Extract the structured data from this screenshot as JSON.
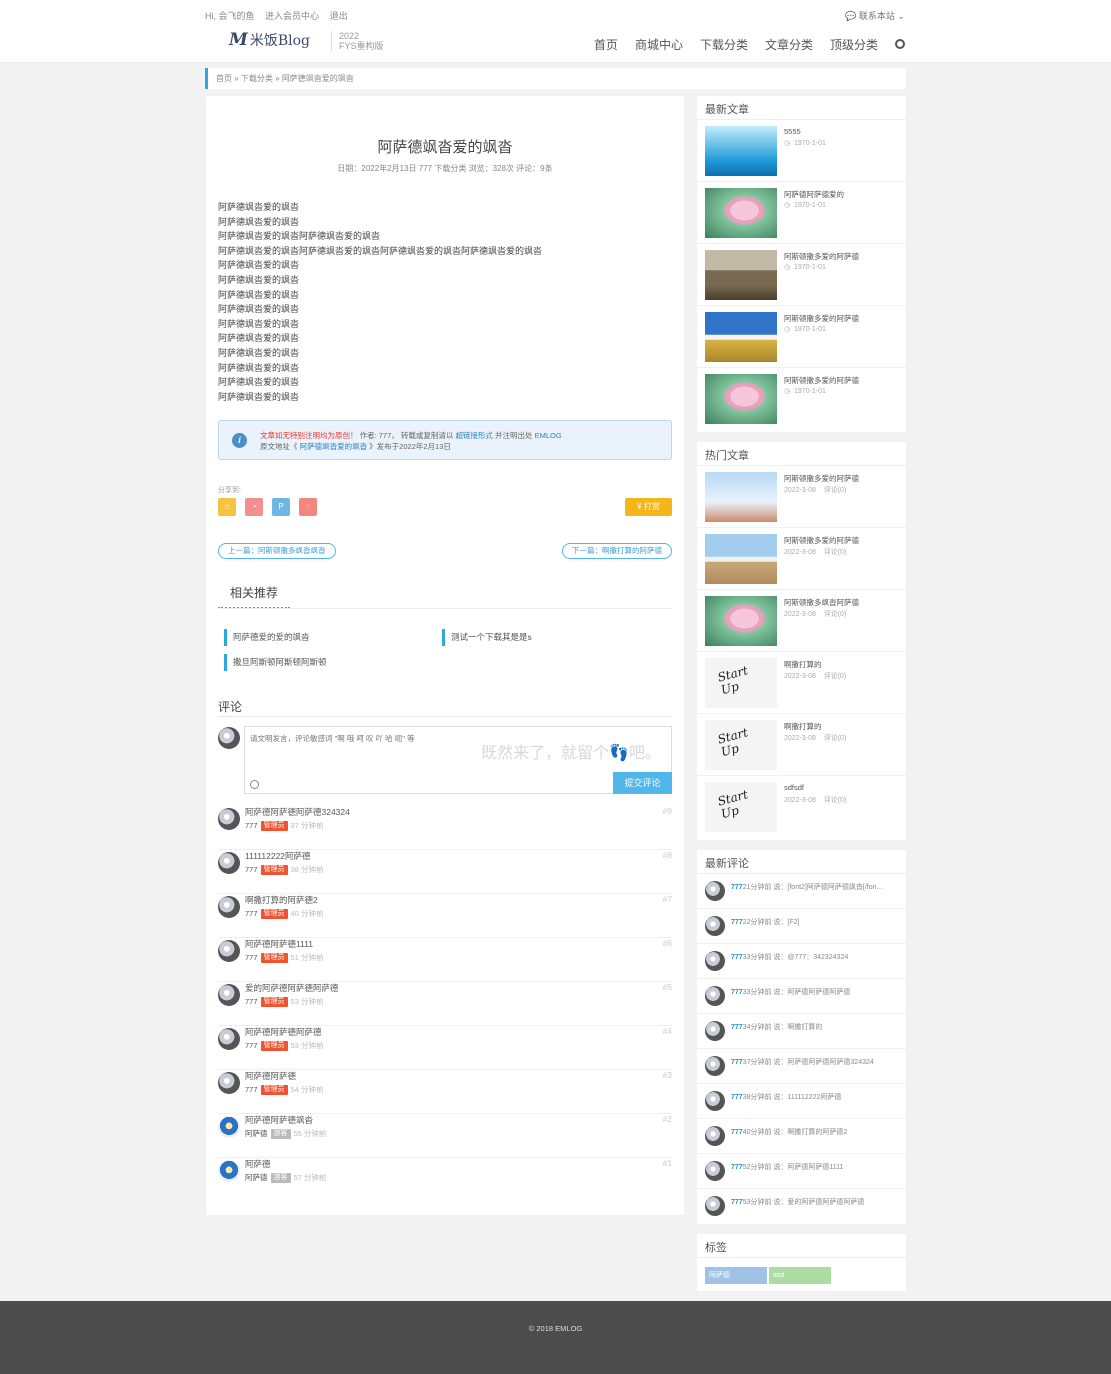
{
  "topbar": {
    "greeting": "Hi, 会飞的鱼",
    "member_center": "进入会员中心",
    "logout": "退出",
    "contact": "联系本站",
    "logo_mark": "M",
    "logo_text": "米饭Blog",
    "version_year": "2022",
    "version_name": "FYS重构版",
    "nav": [
      "首页",
      "商城中心",
      "下载分类",
      "文章分类",
      "顶级分类"
    ]
  },
  "breadcrumb": [
    "首页",
    "下载分类",
    "阿萨德飒沓爱的飒沓"
  ],
  "article": {
    "title": "阿萨德飒沓爱的飒沓",
    "meta": "日期：2022年2月13日  777  下载分类  浏览：328次  评论：9条",
    "lines": [
      "阿萨德飒沓爱的飒沓",
      "阿萨德飒沓爱的飒沓",
      "阿萨德飒沓爱的飒沓阿萨德飒沓爱的飒沓",
      "阿萨德飒沓爱的飒沓阿萨德飒沓爱的飒沓阿萨德飒沓爱的飒沓阿萨德飒沓爱的飒沓",
      "阿萨德飒沓爱的飒沓",
      "阿萨德飒沓爱的飒沓",
      "阿萨德飒沓爱的飒沓",
      "阿萨德飒沓爱的飒沓",
      "阿萨德飒沓爱的飒沓",
      "阿萨德飒沓爱的飒沓",
      "阿萨德飒沓爱的飒沓",
      "阿萨德飒沓爱的飒沓",
      "阿萨德飒沓爱的飒沓",
      "阿萨德飒沓爱的飒沓"
    ],
    "notice_red": "文章如无特别注明均为原创！",
    "notice_mid": " 作者: 777，  转载或复制请以 ",
    "notice_link": "超链接形式",
    "notice_end": " 并注明出处 ",
    "notice_site": "EMLOG",
    "notice2_pre": "原文地址《 ",
    "notice2_link": "阿萨德飒沓爱的飒沓",
    "notice2_post": " 》发布于2022年2月13日",
    "share_label": "分享到:",
    "reward": "¥ 打赏",
    "prev": "上一篇：阿斯顿撒多飒沓飒沓",
    "next": "下一篇：啊撒打算的阿萨德",
    "related_title": "相关推荐",
    "related": [
      "阿萨德爱的爱的飒沓",
      "测试一个下载其是是s",
      "撒旦阿斯顿阿斯顿阿斯顿"
    ]
  },
  "comment_form": {
    "title": "评论",
    "placeholder": "请文明发言，评论敏感词 \"啊 哦 呵 叹 吖 哈 呃\" 等",
    "slogan": "既然来了，就留个👣吧。",
    "submit": "提交评论"
  },
  "comments": [
    {
      "text": "阿萨德阿萨德阿萨德324324",
      "user": "777",
      "role": "管理员",
      "time": "37 分钟前",
      "num": "#9"
    },
    {
      "text": "111112222阿萨德",
      "user": "777",
      "role": "管理员",
      "time": "38 分钟前",
      "num": "#8"
    },
    {
      "text": "啊撒打算的阿萨德2",
      "user": "777",
      "role": "管理员",
      "time": "40 分钟前",
      "num": "#7"
    },
    {
      "text": "阿萨德阿萨德1111",
      "user": "777",
      "role": "管理员",
      "time": "51 分钟前",
      "num": "#6"
    },
    {
      "text": "爱的阿萨德阿萨德阿萨德",
      "user": "777",
      "role": "管理员",
      "time": "53 分钟前",
      "num": "#5"
    },
    {
      "text": "阿萨德阿萨德阿萨德",
      "user": "777",
      "role": "管理员",
      "time": "53 分钟前",
      "num": "#4"
    },
    {
      "text": "阿萨德阿萨德",
      "user": "777",
      "role": "管理员",
      "time": "54 分钟前",
      "num": "#3"
    },
    {
      "text": "阿萨德阿萨德飒沓",
      "user": "阿萨德",
      "role": "游客",
      "time": "55 分钟前",
      "num": "#2"
    },
    {
      "text": "阿萨德",
      "user": "阿萨德",
      "role": "游客",
      "time": "57 分钟前",
      "num": "#1"
    }
  ],
  "sidebar": {
    "latest_title": "最新文章",
    "latest": [
      {
        "title": "5555",
        "date": "1970-1-01"
      },
      {
        "title": "阿萨德阿萨德爱的",
        "date": "1970-1-01"
      },
      {
        "title": "阿斯顿撒多爱的阿萨德",
        "date": "1970-1-01"
      },
      {
        "title": "阿斯顿撒多爱的阿萨德",
        "date": "1970-1-01"
      },
      {
        "title": "阿斯顿撒多爱的阿萨德",
        "date": "1970-1-01"
      }
    ],
    "hot_title": "热门文章",
    "hot": [
      {
        "title": "阿斯顿撒多爱的阿萨德",
        "date": "2022-3-08",
        "comments": "评论(0)"
      },
      {
        "title": "阿斯顿撒多爱的阿萨德",
        "date": "2022-3-08",
        "comments": "评论(0)"
      },
      {
        "title": "阿斯顿撒多飒沓阿萨德",
        "date": "2022-3-08",
        "comments": "评论(0)"
      },
      {
        "title": "啊撒打算的",
        "date": "2022-3-08",
        "comments": "评论(0)"
      },
      {
        "title": "啊撒打算的",
        "date": "2022-3-08",
        "comments": "评论(0)"
      },
      {
        "title": "sdfsdf",
        "date": "2022-3-08",
        "comments": "评论(0)"
      }
    ],
    "recent_comments_title": "最新评论",
    "recent_comments": [
      {
        "user": "777",
        "rest": "21分钟前 说：[font2]阿萨德阿萨德飒沓[/fon..."
      },
      {
        "user": "777",
        "rest": "22分钟前 说：[F2]"
      },
      {
        "user": "777",
        "rest": "33分钟前 说：@777：342324324"
      },
      {
        "user": "777",
        "rest": "33分钟前 说：阿萨德阿萨德阿萨德"
      },
      {
        "user": "777",
        "rest": "34分钟前 说：啊撒打算的"
      },
      {
        "user": "777",
        "rest": "37分钟前 说：阿萨德阿萨德阿萨德324324"
      },
      {
        "user": "777",
        "rest": "38分钟前 说：111112222阿萨德"
      },
      {
        "user": "777",
        "rest": "40分钟前 说：啊撒打算的阿萨德2"
      },
      {
        "user": "777",
        "rest": "52分钟前 说：阿萨德阿萨德1111"
      },
      {
        "user": "777",
        "rest": "53分钟前 说：爱的阿萨德阿萨德阿萨德"
      }
    ],
    "tags_title": "标签",
    "tags": [
      "阿萨德",
      "asd"
    ]
  },
  "footer": "© 2018 EMLOG",
  "colors": {
    "accent": "#2ea7e0",
    "admin_badge": "#f0532f",
    "guest_badge": "#bbbbbb",
    "reward": "#f5b61c"
  },
  "icons": [
    "chat-icon",
    "search-icon",
    "calendar-icon",
    "user-icon",
    "folder-icon",
    "eye-icon",
    "comment-icon",
    "info-icon",
    "star-icon",
    "weibo-icon",
    "pinterest-icon",
    "qq-icon",
    "smile-icon",
    "clock-icon"
  ]
}
